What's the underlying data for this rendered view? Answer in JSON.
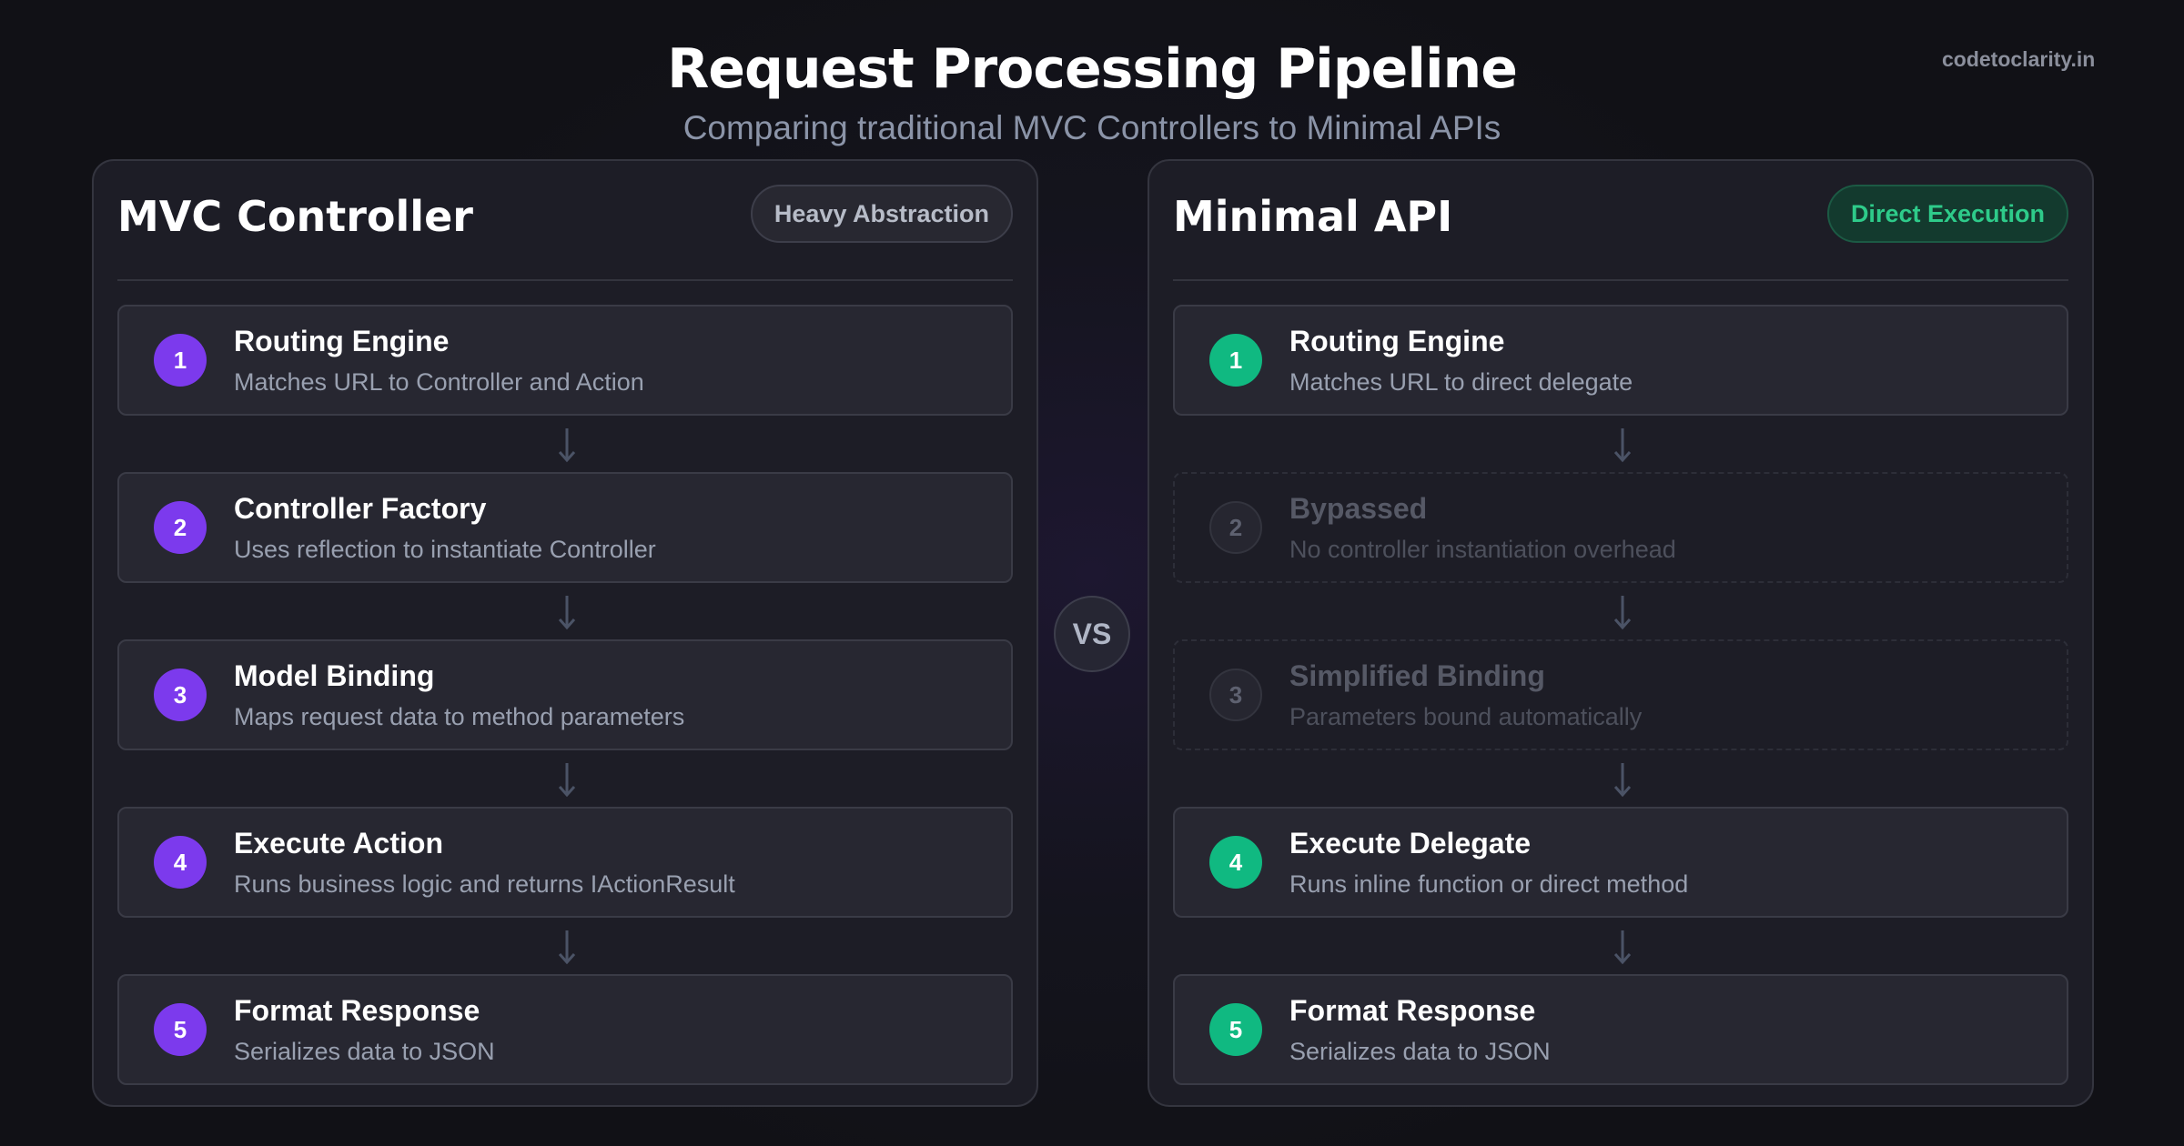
{
  "header": {
    "title": "Request Processing Pipeline",
    "subtitle": "Comparing traditional MVC Controllers to Minimal APIs",
    "brand": "codetoclarity.in"
  },
  "colors": {
    "purple_accent": "#7c3aed",
    "green_accent": "#10b981",
    "green_badge_text": "#2ecb8a"
  },
  "vs_label": "VS",
  "mvc": {
    "title": "MVC Controller",
    "badge": "Heavy Abstraction",
    "steps": [
      {
        "num": "1",
        "title": "Routing Engine",
        "desc": "Matches URL to Controller and Action"
      },
      {
        "num": "2",
        "title": "Controller Factory",
        "desc": "Uses reflection to instantiate Controller"
      },
      {
        "num": "3",
        "title": "Model Binding",
        "desc": "Maps request data to method parameters"
      },
      {
        "num": "4",
        "title": "Execute Action",
        "desc": "Runs business logic and returns IActionResult"
      },
      {
        "num": "5",
        "title": "Format Response",
        "desc": "Serializes data to JSON"
      }
    ]
  },
  "minimal": {
    "title": "Minimal API",
    "badge": "Direct Execution",
    "steps": [
      {
        "num": "1",
        "title": "Routing Engine",
        "desc": "Matches URL to direct delegate",
        "state": "active"
      },
      {
        "num": "2",
        "title": "Bypassed",
        "desc": "No controller instantiation overhead",
        "state": "bypassed"
      },
      {
        "num": "3",
        "title": "Simplified Binding",
        "desc": "Parameters bound automatically",
        "state": "bypassed"
      },
      {
        "num": "4",
        "title": "Execute Delegate",
        "desc": "Runs inline function or direct method",
        "state": "active"
      },
      {
        "num": "5",
        "title": "Format Response",
        "desc": "Serializes data to JSON",
        "state": "active"
      }
    ]
  }
}
